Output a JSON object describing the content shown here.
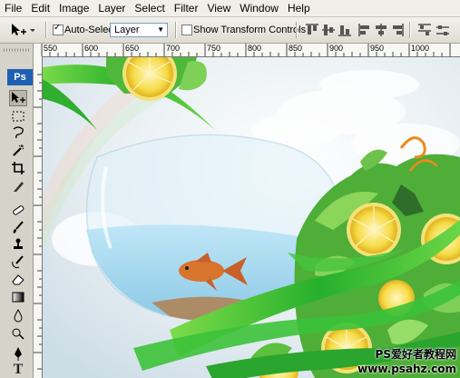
{
  "menu": [
    "File",
    "Edit",
    "Image",
    "Layer",
    "Select",
    "Filter",
    "View",
    "Window",
    "Help"
  ],
  "options": {
    "auto_select_label": "Auto-Select:",
    "auto_select_checked": true,
    "layer_value": "Layer",
    "show_transform_label": "Show Transform Controls",
    "show_transform_checked": false
  },
  "ruler": {
    "ticks": [
      "550",
      "600",
      "650",
      "700",
      "750",
      "800",
      "850",
      "900",
      "950",
      "1000"
    ]
  },
  "app_logo": "Ps",
  "tools": [
    "move-tool",
    "marquee-tool",
    "lasso-tool",
    "magic-wand-tool",
    "crop-tool",
    "slice-tool",
    "healing-brush-tool",
    "brush-tool",
    "clone-stamp-tool",
    "history-brush-tool",
    "eraser-tool",
    "gradient-tool",
    "blur-tool",
    "dodge-tool",
    "pen-tool",
    "type-tool"
  ],
  "watermark": {
    "line1": "PS爱好者教程网",
    "line2": "www.psahz.com"
  },
  "colors": {
    "ps_blue": "#1f5fb3",
    "ribbon_green": "#3cc23a",
    "water_blue": "#9fd4f0",
    "goldfish_orange": "#d8742c",
    "lemon_yellow": "#f4d43a"
  }
}
